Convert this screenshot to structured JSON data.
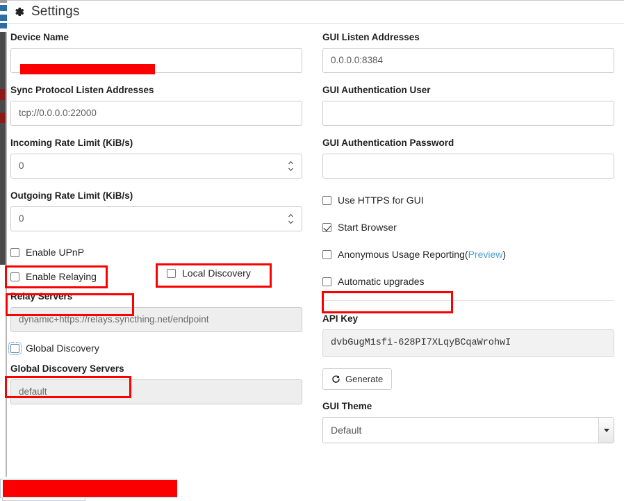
{
  "header": {
    "title": "Settings",
    "icon": "gear-icon"
  },
  "left_column": {
    "device_name": {
      "label": "Device Name",
      "value": "",
      "redacted": true
    },
    "sync_protocol_listen_addresses": {
      "label": "Sync Protocol Listen Addresses",
      "value": "tcp://0.0.0.0:22000"
    },
    "incoming_rate_limit": {
      "label": "Incoming Rate Limit (KiB/s)",
      "value": "0"
    },
    "outgoing_rate_limit": {
      "label": "Outgoing Rate Limit (KiB/s)",
      "value": "0"
    },
    "checkboxes": [
      {
        "name": "enable-upnp",
        "label": "Enable UPnP",
        "checked": false,
        "annotated": true,
        "focused": false
      },
      {
        "name": "local-discovery",
        "label": "Local Discovery",
        "checked": false,
        "annotated": true,
        "focused": false
      },
      {
        "name": "enable-relaying",
        "label": "Enable Relaying",
        "checked": false,
        "annotated": true,
        "focused": false
      },
      {
        "name": "global-discovery",
        "label": "Global Discovery",
        "checked": false,
        "annotated": true,
        "focused": true
      }
    ],
    "relay_servers": {
      "label": "Relay Servers",
      "value": "dynamic+https://relays.syncthing.net/endpoint"
    },
    "global_discovery_servers": {
      "label": "Global Discovery Servers",
      "value": "default"
    }
  },
  "right_column": {
    "gui_listen_addresses": {
      "label": "GUI Listen Addresses",
      "value": "0.0.0.0:8384"
    },
    "gui_authentication_user": {
      "label": "GUI Authentication User",
      "value": ""
    },
    "gui_authentication_password": {
      "label": "GUI Authentication Password",
      "value": ""
    },
    "checkboxes": [
      {
        "name": "use-https-for-gui",
        "label": "Use HTTPS for GUI",
        "checked": false,
        "annotated": false
      },
      {
        "name": "start-browser",
        "label": "Start Browser",
        "checked": true,
        "annotated": false
      },
      {
        "name": "anonymous-usage-reporting",
        "label": "Anonymous Usage Reporting",
        "checked": false,
        "annotated": false,
        "suffix_open": " (",
        "link": "Preview",
        "suffix_close": ")"
      },
      {
        "name": "automatic-upgrades",
        "label": "Automatic upgrades",
        "checked": false,
        "annotated": true
      }
    ],
    "api_key": {
      "label": "API Key",
      "value": "dvbGugM1sfi-628PI7XLqyBCqaWrohwI"
    },
    "generate_button": {
      "label": "Generate",
      "icon": "refresh-icon"
    },
    "gui_theme": {
      "label": "GUI Theme",
      "selected": "Default",
      "options": [
        "Default"
      ]
    }
  },
  "colors": {
    "annotation_red": "#fb0000",
    "link_blue": "#4b9fd5",
    "label_dark": "#1f1f1f"
  }
}
